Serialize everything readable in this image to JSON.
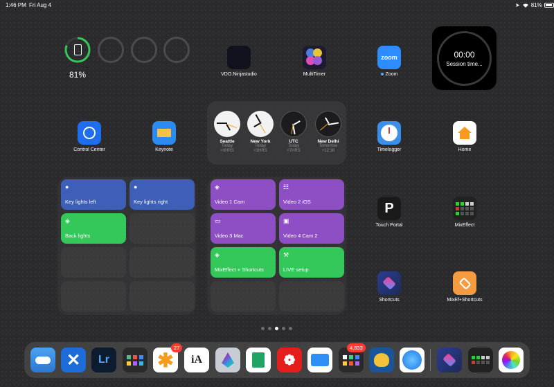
{
  "status_bar": {
    "time": "1:46 PM",
    "date": "Fri Aug 4",
    "battery": "81%"
  },
  "battery_widget": {
    "percent": "81%",
    "level": 0.81
  },
  "apps": {
    "vdo": "VDO.Ninjastudio",
    "multitimer": "MultiTimer",
    "zoom": "Zoom",
    "zoom_icon_text": "zoom",
    "control_center": "Control Center",
    "keynote": "Keynote",
    "timelogger": "Timelogger",
    "home": "Home",
    "touch_portal": "Touch Portal",
    "mixeffect": "MixEffect",
    "shortcuts": "Shortcuts",
    "mixef_shortcuts": "MixEf+Shortcuts"
  },
  "timer_widget": {
    "time": "00:00",
    "label": "Session time..."
  },
  "world_clock": [
    {
      "city": "Seattle",
      "day": "Today",
      "offset": "+0HRS"
    },
    {
      "city": "New York",
      "day": "Today",
      "offset": "+3HRS"
    },
    {
      "city": "UTC",
      "day": "Today",
      "offset": "+7HRS"
    },
    {
      "city": "New Delhi",
      "day": "Tomorrow",
      "offset": "+12:30"
    }
  ],
  "shortcuts_left": [
    {
      "label": "Key lights left",
      "color": "#3d5fb8"
    },
    {
      "label": "Key lights right",
      "color": "#3d5fb8"
    },
    {
      "label": "Back lights",
      "color": "#34c759"
    }
  ],
  "shortcuts_right": [
    {
      "label": "Video 1 Cam",
      "color": "#8e4fc5"
    },
    {
      "label": "Video 2 iOS",
      "color": "#8e4fc5"
    },
    {
      "label": "Video 3 Mac",
      "color": "#8e4fc5"
    },
    {
      "label": "Video 4 Cam 2",
      "color": "#8e4fc5"
    },
    {
      "label": "MixEffect + Shortcuts",
      "color": "#34c759"
    },
    {
      "label": "LIVE setup",
      "color": "#34c759"
    }
  ],
  "dock": {
    "badge_1": "27",
    "badge_2": "4,833",
    "lightroom_text": "Lr",
    "ia_writer_text": "iA"
  }
}
